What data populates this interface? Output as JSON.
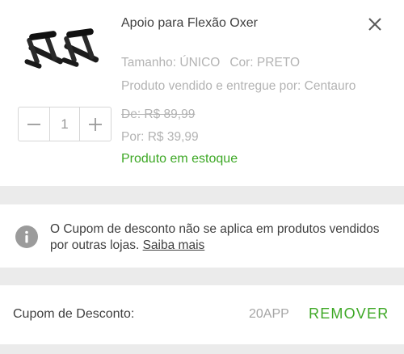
{
  "product": {
    "title": "Apoio para Flexão Oxer",
    "image_icon": "push-up-bars-image",
    "size": "Tamanho: ÚNICO",
    "color": "Cor: PRETO",
    "seller": "Produto vendido e entregue por: Centauro",
    "old_price": "De: R$  89,99",
    "new_price": "Por: R$  39,99",
    "stock": "Produto em estoque",
    "quantity": "1",
    "close_icon": "close-icon"
  },
  "info": {
    "icon": "info-icon",
    "message": "O Cupom de desconto não se aplica em produtos vendidos por outras lojas.",
    "link": "Saiba mais"
  },
  "coupon": {
    "label": "Cupom de Desconto:",
    "code": "20APP",
    "remove_label": "REMOVER"
  },
  "colors": {
    "accent_green": "#3da825",
    "muted_text": "#b3b3b3",
    "background": "#ebebeb"
  }
}
